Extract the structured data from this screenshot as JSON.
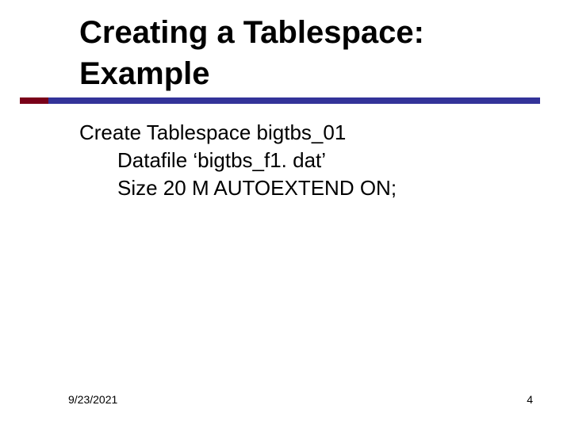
{
  "title": {
    "line1": "Creating a Tablespace:",
    "line2": "Example"
  },
  "body": {
    "line1": "Create Tablespace bigtbs_01",
    "line2": "Datafile ‘bigtbs_f1. dat’",
    "line3": "Size 20 M AUTOEXTEND ON;"
  },
  "footer": {
    "date": "9/23/2021",
    "page_number": "4"
  },
  "colors": {
    "accent": "#7a0019",
    "underline": "#333399"
  }
}
